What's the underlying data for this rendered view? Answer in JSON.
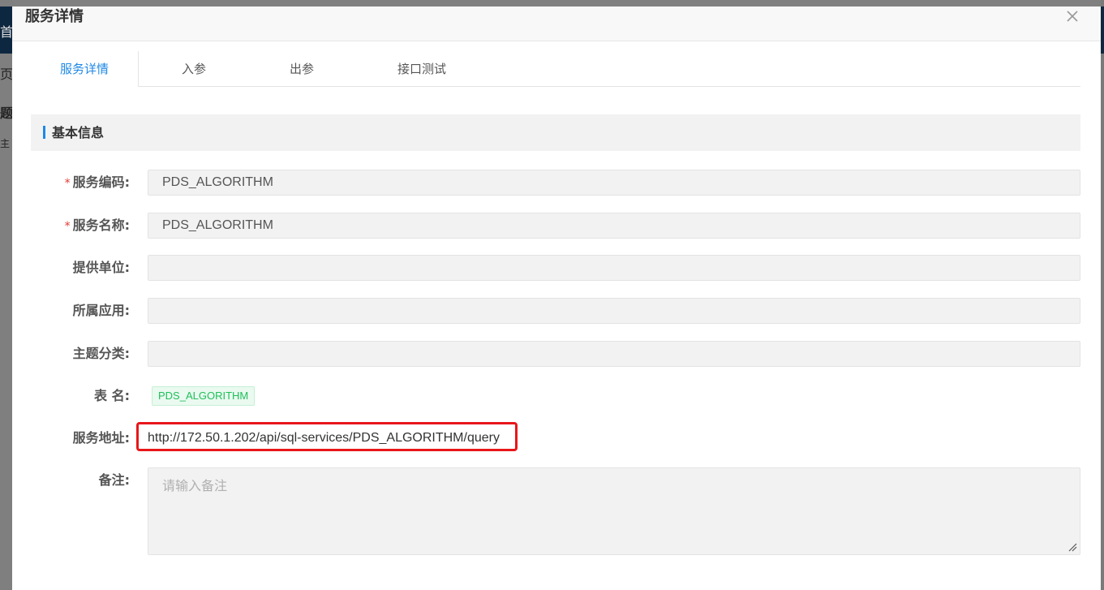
{
  "background": {
    "fragments": [
      "首",
      "页",
      "题分",
      "主"
    ]
  },
  "dialog": {
    "title": "服务详情",
    "close_icon": "close-icon"
  },
  "tabs": [
    {
      "label": "服务详情",
      "active": true
    },
    {
      "label": "入参",
      "active": false
    },
    {
      "label": "出参",
      "active": false
    },
    {
      "label": "接口测试",
      "active": false
    }
  ],
  "section": {
    "title": "基本信息"
  },
  "form": {
    "service_code": {
      "label": "服务编码:",
      "required": true,
      "value": "PDS_ALGORITHM"
    },
    "service_name": {
      "label": "服务名称:",
      "required": true,
      "value": "PDS_ALGORITHM"
    },
    "provider": {
      "label": "提供单位:",
      "value": ""
    },
    "application": {
      "label": "所属应用:",
      "value": ""
    },
    "topic_category": {
      "label": "主题分类:",
      "value": ""
    },
    "table_name": {
      "label": "表 名:",
      "tag": "PDS_ALGORITHM"
    },
    "service_url": {
      "label": "服务地址:",
      "value": "http://172.50.1.202/api/sql-services/PDS_ALGORITHM/query"
    },
    "remark": {
      "label": "备注:",
      "placeholder": "请输入备注"
    }
  },
  "colors": {
    "accent": "#1e88e5",
    "highlight_border": "#e8171b",
    "tag_green": "#1fbf5a",
    "required_star": "#e53935"
  }
}
